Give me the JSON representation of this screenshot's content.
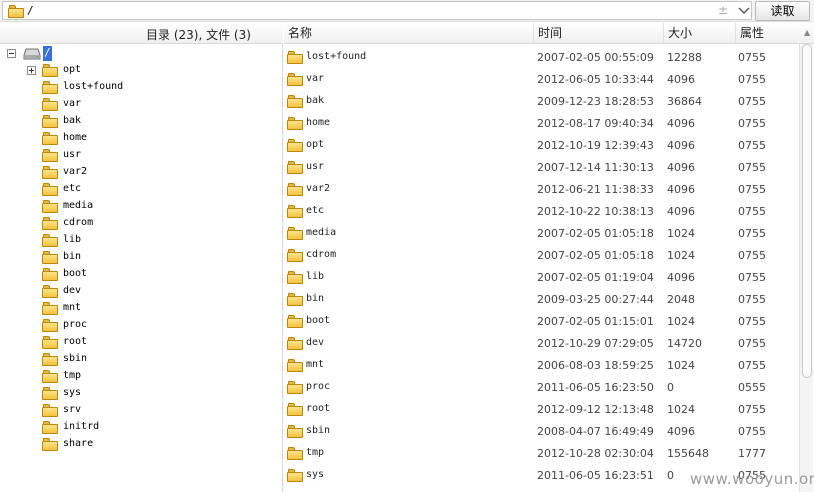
{
  "path_bar": {
    "path_value": "/",
    "clear_symbol": "±",
    "dropdown_icon": "chevron-down-icon",
    "read_button_label": "读取"
  },
  "tree": {
    "header": "目录 (23), 文件 (3)",
    "root_label": "/",
    "root_icon": "drive-icon",
    "items": [
      {
        "label": "opt",
        "expander": "plus"
      },
      {
        "label": "lost+found"
      },
      {
        "label": "var"
      },
      {
        "label": "bak"
      },
      {
        "label": "home"
      },
      {
        "label": "usr"
      },
      {
        "label": "var2"
      },
      {
        "label": "etc"
      },
      {
        "label": "media"
      },
      {
        "label": "cdrom"
      },
      {
        "label": "lib"
      },
      {
        "label": "bin"
      },
      {
        "label": "boot"
      },
      {
        "label": "dev"
      },
      {
        "label": "mnt"
      },
      {
        "label": "proc"
      },
      {
        "label": "root"
      },
      {
        "label": "sbin"
      },
      {
        "label": "tmp"
      },
      {
        "label": "sys"
      },
      {
        "label": "srv"
      },
      {
        "label": "initrd"
      },
      {
        "label": "share"
      }
    ]
  },
  "list": {
    "columns": {
      "name": "名称",
      "time": "时间",
      "size": "大小",
      "perm": "属性"
    },
    "rows": [
      {
        "name": "lost+found",
        "time": "2007-02-05 00:55:09",
        "size": "12288",
        "perm": "0755"
      },
      {
        "name": "var",
        "time": "2012-06-05 10:33:44",
        "size": "4096",
        "perm": "0755"
      },
      {
        "name": "bak",
        "time": "2009-12-23 18:28:53",
        "size": "36864",
        "perm": "0755"
      },
      {
        "name": "home",
        "time": "2012-08-17 09:40:34",
        "size": "4096",
        "perm": "0755"
      },
      {
        "name": "opt",
        "time": "2012-10-19 12:39:43",
        "size": "4096",
        "perm": "0755"
      },
      {
        "name": "usr",
        "time": "2007-12-14 11:30:13",
        "size": "4096",
        "perm": "0755"
      },
      {
        "name": "var2",
        "time": "2012-06-21 11:38:33",
        "size": "4096",
        "perm": "0755"
      },
      {
        "name": "etc",
        "time": "2012-10-22 10:38:13",
        "size": "4096",
        "perm": "0755"
      },
      {
        "name": "media",
        "time": "2007-02-05 01:05:18",
        "size": "1024",
        "perm": "0755"
      },
      {
        "name": "cdrom",
        "time": "2007-02-05 01:05:18",
        "size": "1024",
        "perm": "0755"
      },
      {
        "name": "lib",
        "time": "2007-02-05 01:19:04",
        "size": "4096",
        "perm": "0755"
      },
      {
        "name": "bin",
        "time": "2009-03-25 00:27:44",
        "size": "2048",
        "perm": "0755"
      },
      {
        "name": "boot",
        "time": "2007-02-05 01:15:01",
        "size": "1024",
        "perm": "0755"
      },
      {
        "name": "dev",
        "time": "2012-10-29 07:29:05",
        "size": "14720",
        "perm": "0755"
      },
      {
        "name": "mnt",
        "time": "2006-08-03 18:59:25",
        "size": "1024",
        "perm": "0755"
      },
      {
        "name": "proc",
        "time": "2011-06-05 16:23:50",
        "size": "0",
        "perm": "0555"
      },
      {
        "name": "root",
        "time": "2012-09-12 12:13:48",
        "size": "1024",
        "perm": "0755"
      },
      {
        "name": "sbin",
        "time": "2008-04-07 16:49:49",
        "size": "4096",
        "perm": "0755"
      },
      {
        "name": "tmp",
        "time": "2012-10-28 02:30:04",
        "size": "155648",
        "perm": "1777"
      },
      {
        "name": "sys",
        "time": "2011-06-05 16:23:51",
        "size": "0",
        "perm": "0755"
      }
    ]
  },
  "watermark": "www.wooyun.org",
  "colors": {
    "folder": "#f4c23f",
    "selection": "#3a6fd8"
  }
}
